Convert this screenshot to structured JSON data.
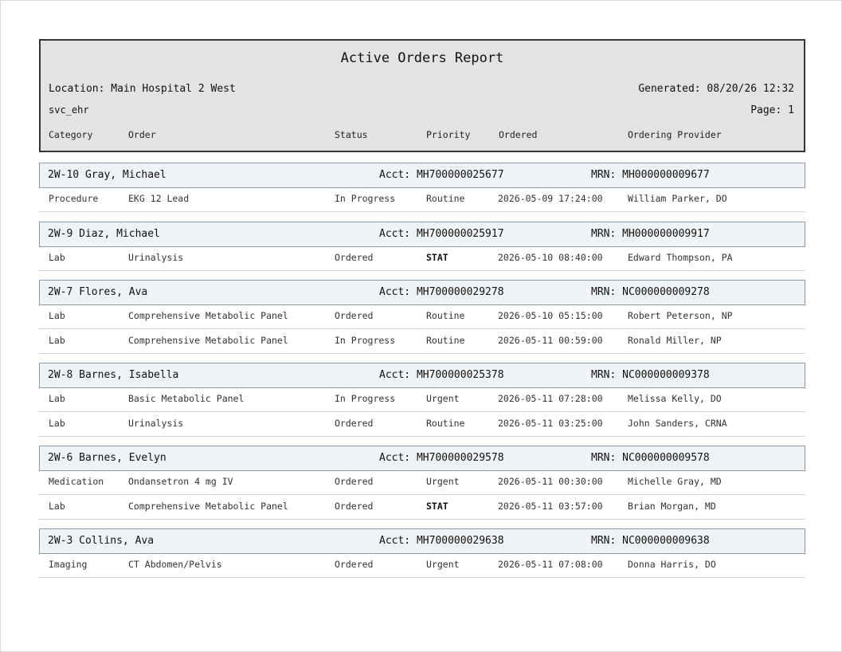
{
  "report": {
    "title": "Active Orders Report",
    "location": "Location: Main Hospital 2 West",
    "generated": "Generated: 08/20/26 12:32",
    "user": "svc_ehr",
    "page": "Page: 1",
    "columns": {
      "category": "Category",
      "order": "Order",
      "status": "Status",
      "priority": "Priority",
      "ordered": "Ordered",
      "provider": "Ordering Provider"
    }
  },
  "patients": [
    {
      "id_name": "2W-10  Gray, Michael",
      "acct": "Acct: MH700000025677",
      "mrn": "MRN: MH000000009677",
      "orders": [
        {
          "category": "Procedure",
          "order": "EKG 12 Lead",
          "status": "In Progress",
          "priority": "Routine",
          "ordered": "2026-05-09 17:24:00",
          "provider": "William Parker, DO"
        }
      ]
    },
    {
      "id_name": "2W-9  Diaz, Michael",
      "acct": "Acct: MH700000025917",
      "mrn": "MRN: MH000000009917",
      "orders": [
        {
          "category": "Lab",
          "order": "Urinalysis",
          "status": "Ordered",
          "priority": "STAT",
          "ordered": "2026-05-10 08:40:00",
          "provider": "Edward Thompson, PA"
        }
      ]
    },
    {
      "id_name": "2W-7  Flores, Ava",
      "acct": "Acct: MH700000029278",
      "mrn": "MRN: NC000000009278",
      "orders": [
        {
          "category": "Lab",
          "order": "Comprehensive Metabolic Panel",
          "status": "Ordered",
          "priority": "Routine",
          "ordered": "2026-05-10 05:15:00",
          "provider": "Robert Peterson, NP"
        },
        {
          "category": "Lab",
          "order": "Comprehensive Metabolic Panel",
          "status": "In Progress",
          "priority": "Routine",
          "ordered": "2026-05-11 00:59:00",
          "provider": "Ronald Miller, NP"
        }
      ]
    },
    {
      "id_name": "2W-8  Barnes, Isabella",
      "acct": "Acct: MH700000025378",
      "mrn": "MRN: NC000000009378",
      "orders": [
        {
          "category": "Lab",
          "order": "Basic Metabolic Panel",
          "status": "In Progress",
          "priority": "Urgent",
          "ordered": "2026-05-11 07:28:00",
          "provider": "Melissa Kelly, DO"
        },
        {
          "category": "Lab",
          "order": "Urinalysis",
          "status": "Ordered",
          "priority": "Routine",
          "ordered": "2026-05-11 03:25:00",
          "provider": "John Sanders, CRNA"
        }
      ]
    },
    {
      "id_name": "2W-6  Barnes, Evelyn",
      "acct": "Acct: MH700000029578",
      "mrn": "MRN: NC000000009578",
      "orders": [
        {
          "category": "Medication",
          "order": "Ondansetron 4 mg IV",
          "status": "Ordered",
          "priority": "Urgent",
          "ordered": "2026-05-11 00:30:00",
          "provider": "Michelle Gray, MD"
        },
        {
          "category": "Lab",
          "order": "Comprehensive Metabolic Panel",
          "status": "Ordered",
          "priority": "STAT",
          "ordered": "2026-05-11 03:57:00",
          "provider": "Brian Morgan, MD"
        }
      ]
    },
    {
      "id_name": "2W-3  Collins, Ava",
      "acct": "Acct: MH700000029638",
      "mrn": "MRN: NC000000009638",
      "orders": [
        {
          "category": "Imaging",
          "order": "CT Abdomen/Pelvis",
          "status": "Ordered",
          "priority": "Urgent",
          "ordered": "2026-05-11 07:08:00",
          "provider": "Donna Harris, DO"
        }
      ]
    }
  ]
}
